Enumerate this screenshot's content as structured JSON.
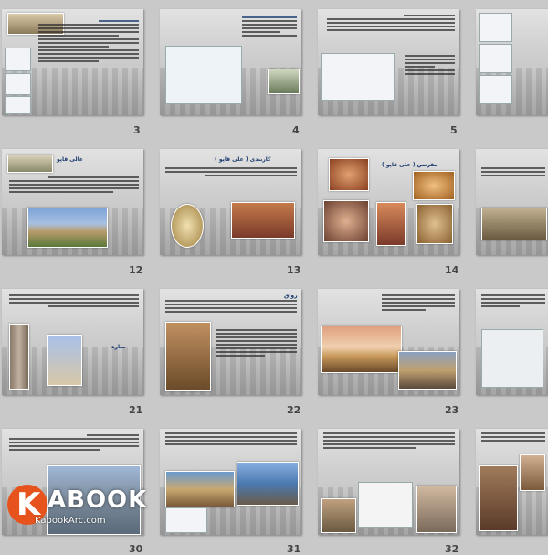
{
  "slides": [
    {
      "num": "3"
    },
    {
      "num": "4"
    },
    {
      "num": "5"
    },
    {
      "num": ""
    },
    {
      "num": "12"
    },
    {
      "num": "13"
    },
    {
      "num": "14"
    },
    {
      "num": ""
    },
    {
      "num": "21"
    },
    {
      "num": "22"
    },
    {
      "num": "23"
    },
    {
      "num": ""
    },
    {
      "num": "30"
    },
    {
      "num": "31"
    },
    {
      "num": "32"
    },
    {
      "num": ""
    }
  ],
  "titles": {
    "s13": "کاربندی ( علی قاپو )",
    "s14": "مقرنس ( علی قاپو )",
    "s21": "مناره",
    "s22": "رواق",
    "s12": "عالی قاپو"
  },
  "watermark": {
    "brand": "ABOOK",
    "letter": "K",
    "url": "KabookArc.com"
  },
  "colors": {
    "accent": "#e6531d",
    "heading": "#1a3b6e"
  }
}
